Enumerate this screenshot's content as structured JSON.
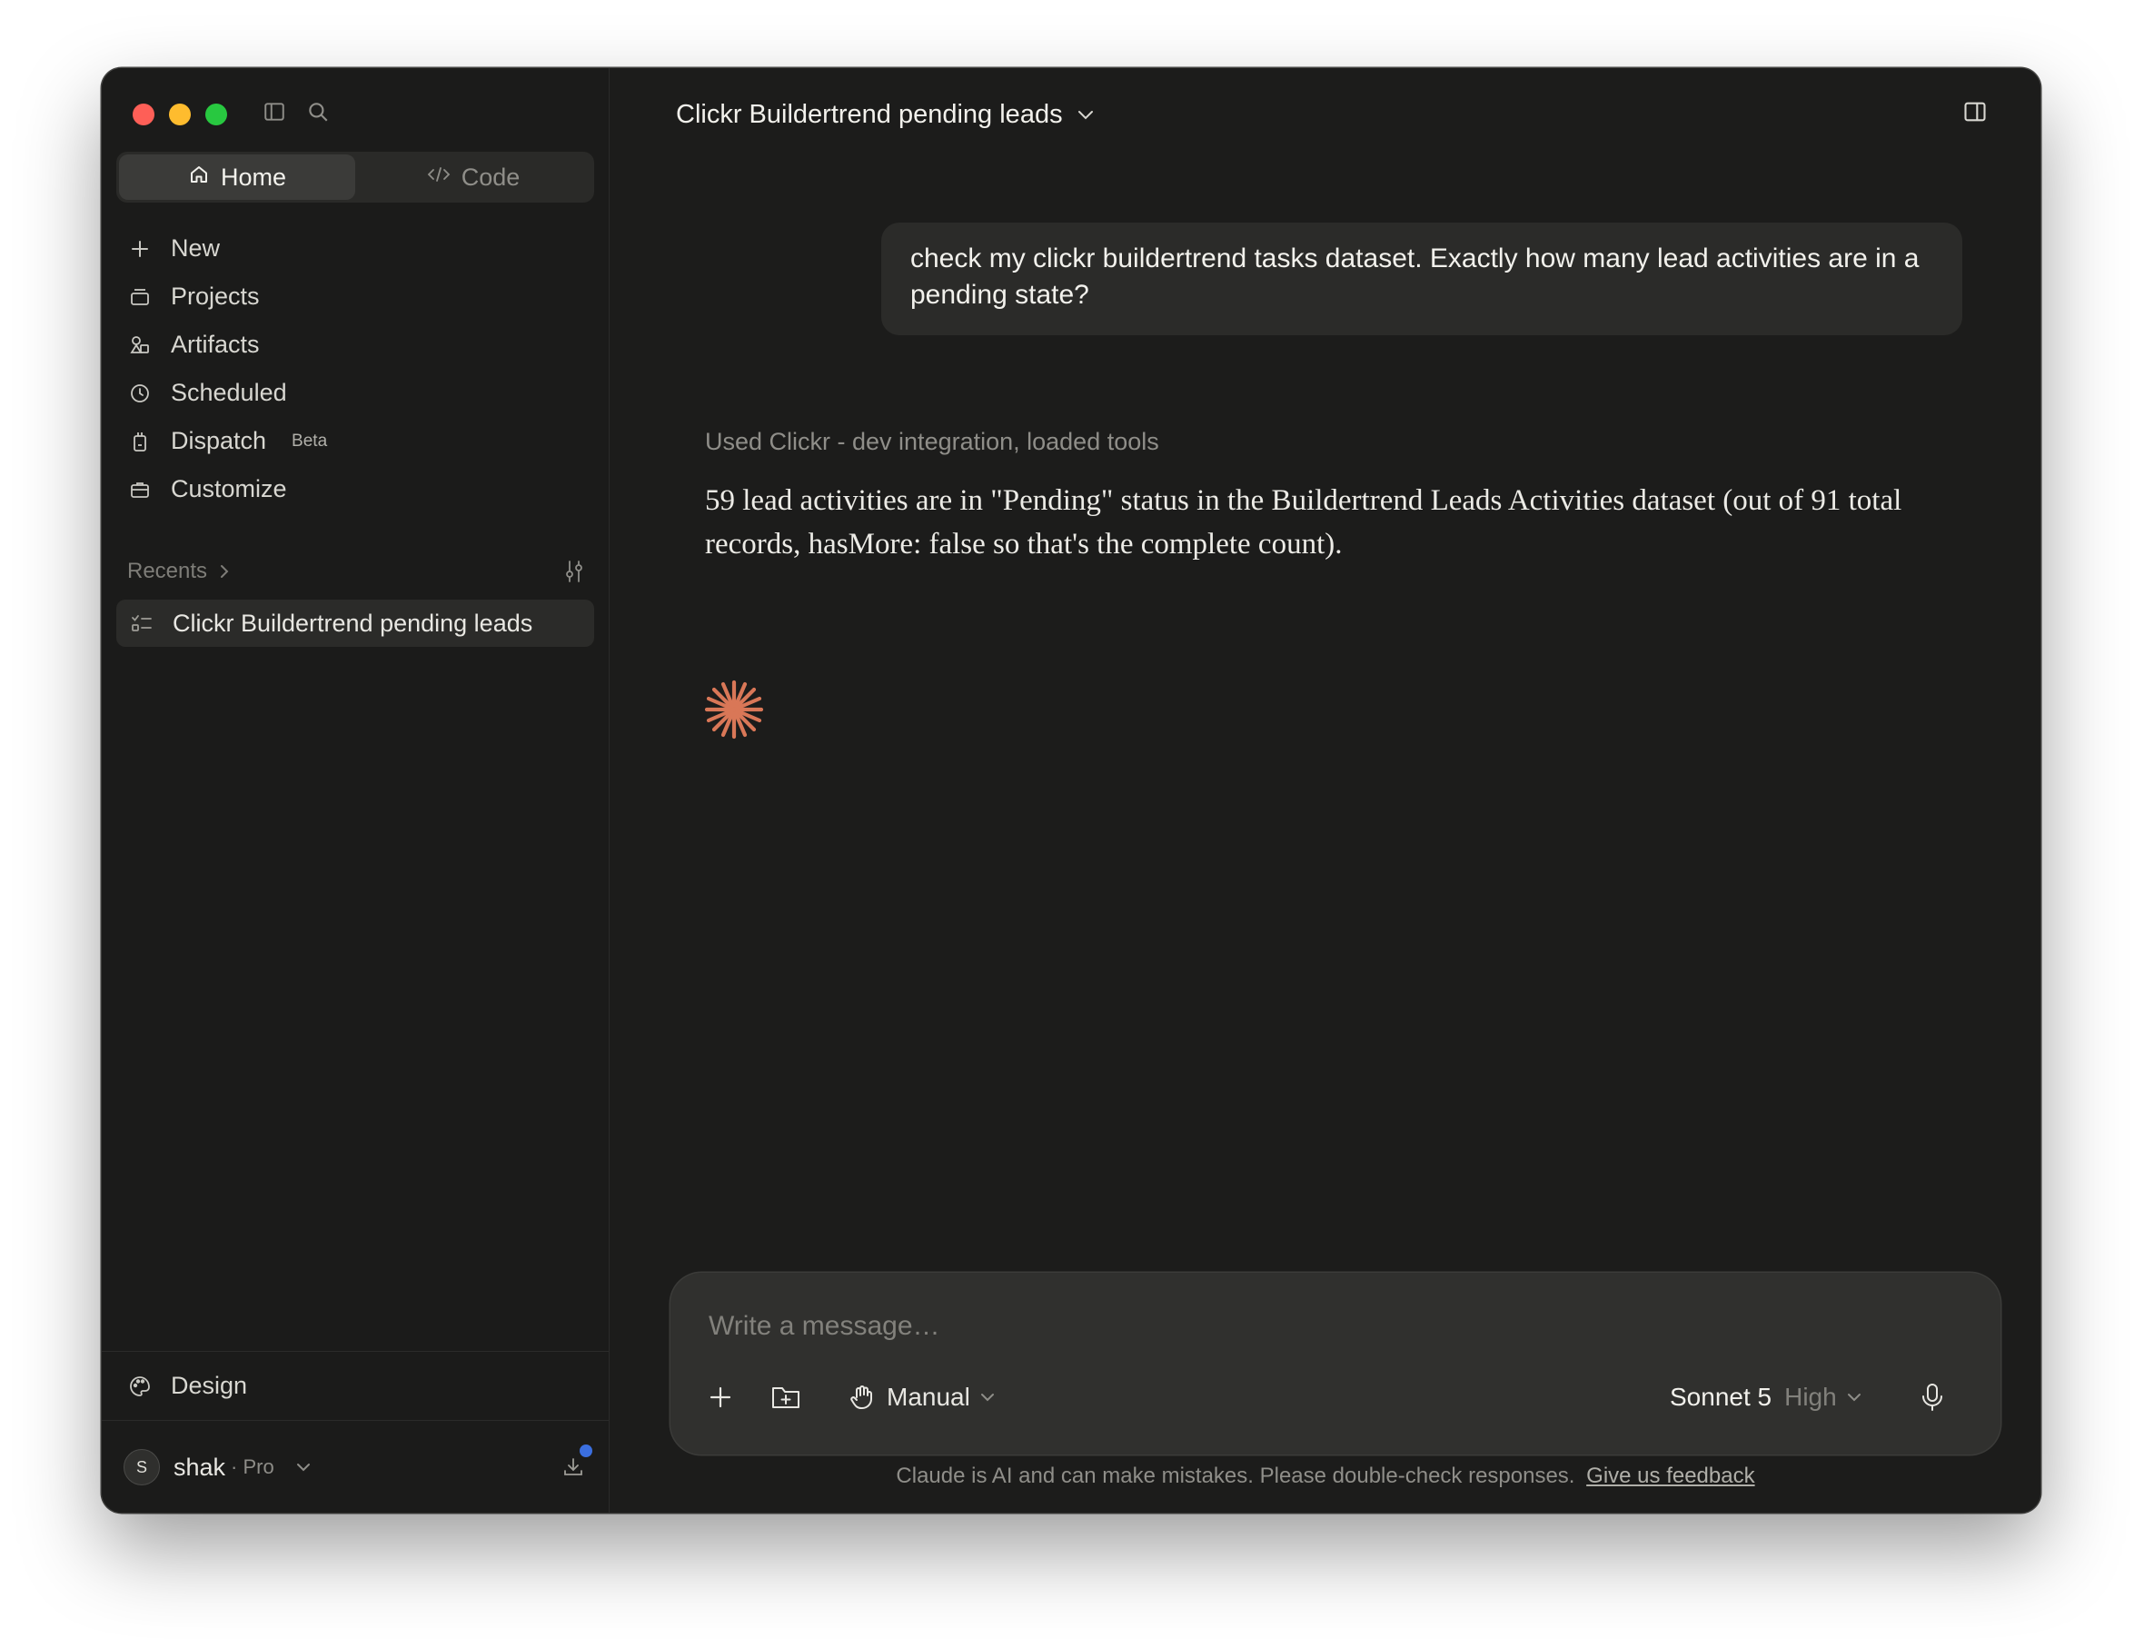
{
  "sidebar": {
    "tabs": [
      {
        "label": "Home",
        "icon": "home-icon",
        "active": true
      },
      {
        "label": "Code",
        "icon": "code-icon",
        "active": false
      }
    ],
    "nav": [
      {
        "label": "New",
        "icon": "plus-icon"
      },
      {
        "label": "Projects",
        "icon": "projects-icon"
      },
      {
        "label": "Artifacts",
        "icon": "artifacts-icon"
      },
      {
        "label": "Scheduled",
        "icon": "clock-icon"
      },
      {
        "label": "Dispatch",
        "icon": "dispatch-icon",
        "badge": "Beta"
      },
      {
        "label": "Customize",
        "icon": "briefcase-icon"
      }
    ],
    "recents_label": "Recents",
    "recents": [
      {
        "label": "Clickr Buildertrend pending leads",
        "icon": "task-list-icon"
      }
    ],
    "design_label": "Design",
    "account": {
      "initial": "S",
      "name": "shak",
      "plan": "· Pro"
    }
  },
  "chat": {
    "title": "Clickr Buildertrend pending leads",
    "user_message": "check my clickr buildertrend tasks dataset. Exactly how many lead activities are in a pending state?",
    "tool_status": "Used Clickr - dev integration, loaded tools",
    "answer": "59 lead activities are in \"Pending\" status in the Buildertrend Leads Activities dataset (out of 91 total records, hasMore: false so that's the complete count)."
  },
  "composer": {
    "placeholder": "Write a message…",
    "mode_label": "Manual",
    "model_name": "Sonnet 5",
    "model_effort": "High"
  },
  "footer": {
    "disclaimer": "Claude is AI and can make mistakes. Please double-check responses.",
    "feedback_link": "Give us feedback"
  },
  "colors": {
    "window_bg": "#1c1c1b",
    "accent_spark": "#d97757",
    "notification_dot": "#3b6fe0"
  }
}
